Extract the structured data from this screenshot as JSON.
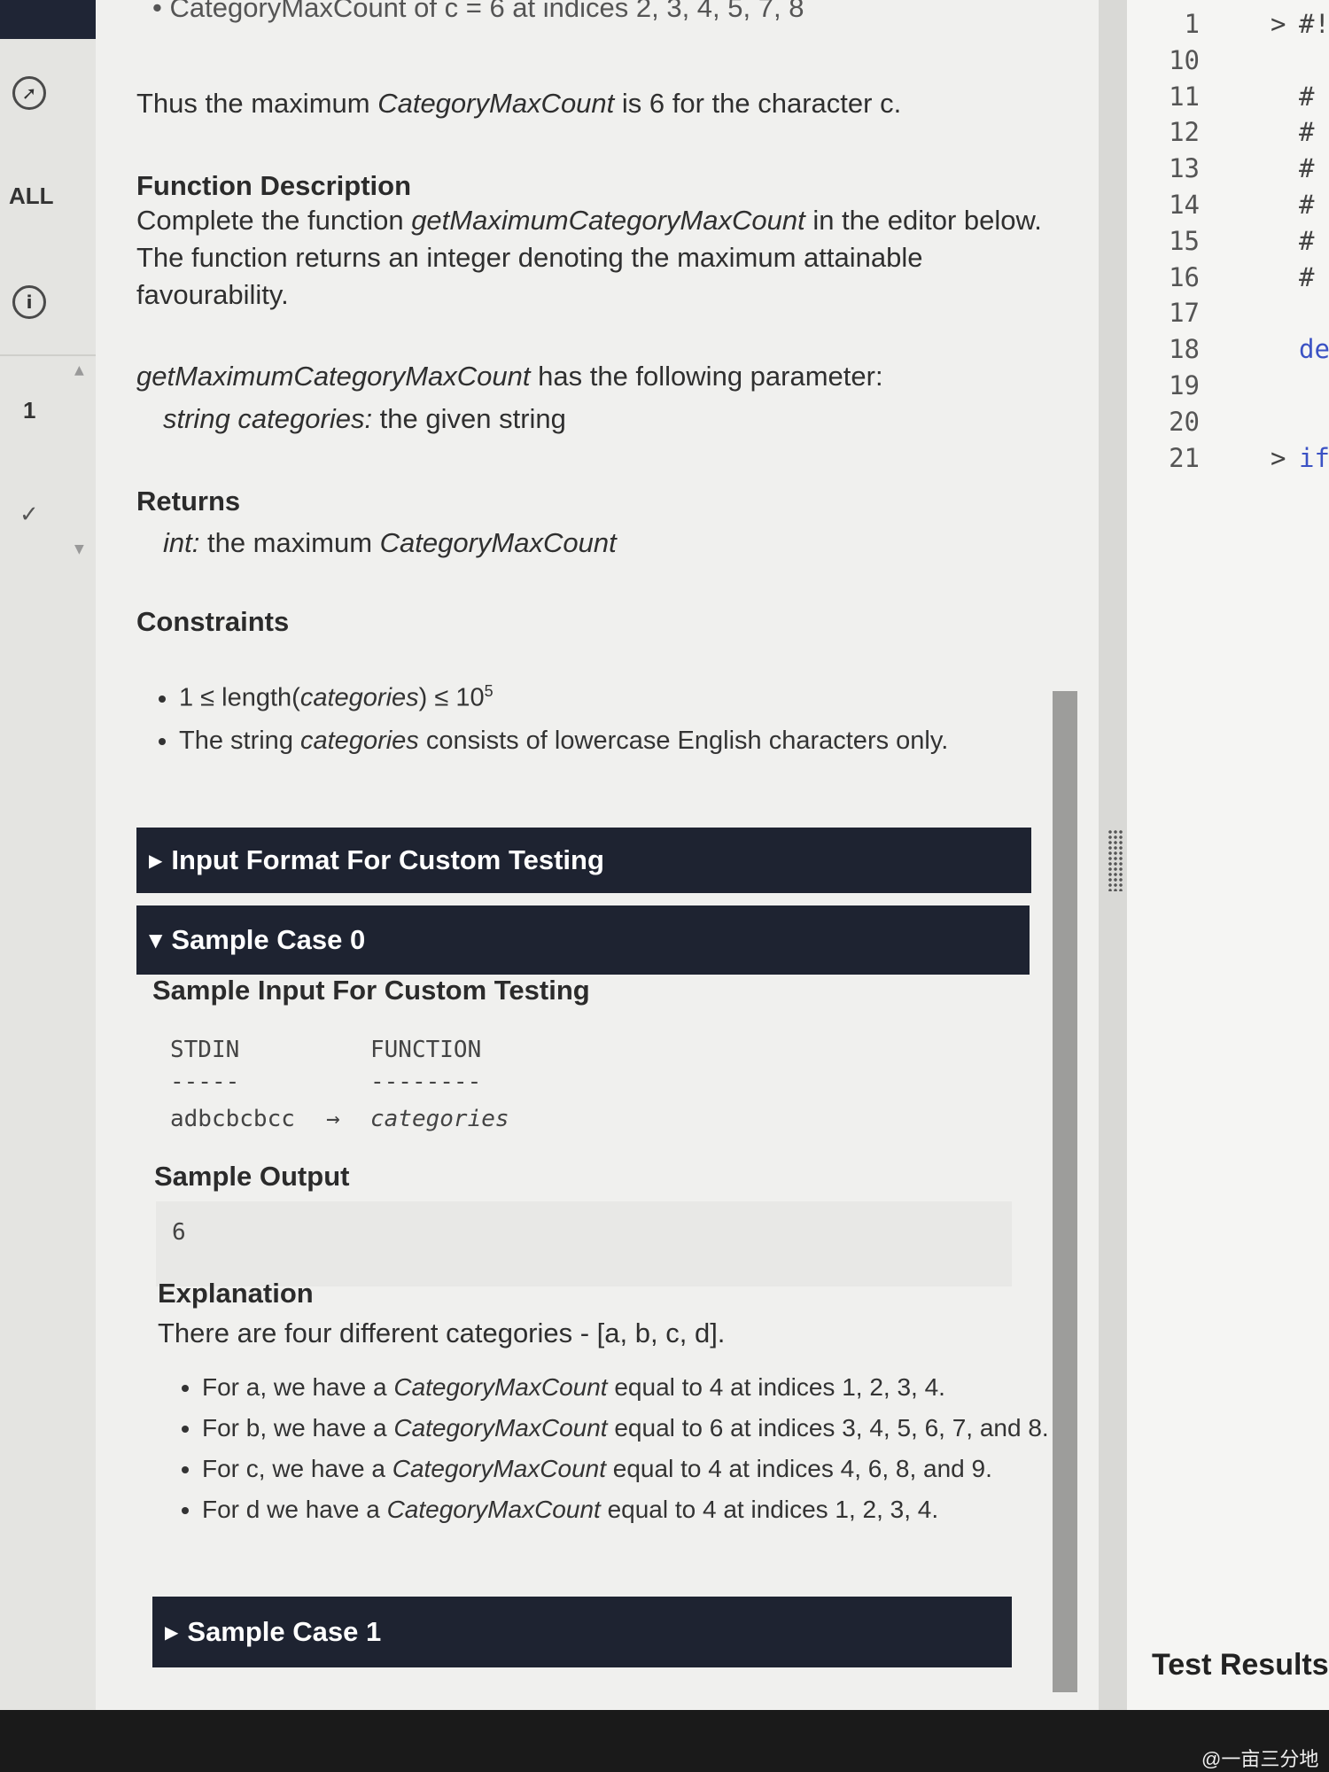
{
  "rail": {
    "filter_label": "ALL",
    "item_number": "1"
  },
  "description": {
    "top_cut_text": "• CategoryMaxCount of c = 6 at indices 2, 3, 4, 5, 7, 8",
    "summary": {
      "pre": "Thus the maximum ",
      "term": "CategoryMaxCount",
      "post": " is 6 for the character c."
    },
    "function_heading": "Function Description",
    "function_body": {
      "pre": "Complete the function ",
      "term": "getMaximumCategoryMaxCount",
      "post": " in the editor below. The function returns an integer denoting the maximum attainable favourability."
    },
    "param_intro": {
      "term": "getMaximumCategoryMaxCount",
      "post": " has the following parameter:"
    },
    "param_line": {
      "term": "string categories:",
      "post": " the given string"
    },
    "returns_heading": "Returns",
    "returns_line": {
      "term": "int:",
      "mid": " the maximum ",
      "term2": "CategoryMaxCount"
    },
    "constraints_heading": "Constraints",
    "constraint1": {
      "pre": "1 ≤ length(",
      "term": "categories",
      "post": ") ≤ 10",
      "sup": "5"
    },
    "constraint2": {
      "pre": "The string ",
      "term": "categories",
      "post": " consists of lowercase English characters only."
    }
  },
  "sections": {
    "input_format": "Input Format For Custom Testing",
    "sample0": "Sample Case 0",
    "sample1": "Sample Case 1"
  },
  "sample0": {
    "input_heading": "Sample Input For Custom Testing",
    "col_stdin": "STDIN",
    "col_function": "FUNCTION",
    "dash_stdin": "-----",
    "dash_function": "--------",
    "stdin_value": "adbcbcbcc",
    "arrow": "→",
    "function_value": "categories",
    "output_heading": "Sample Output",
    "output_value": "6",
    "explanation_heading": "Explanation",
    "explanation_intro": "There are four different categories - [a, b, c, d].",
    "explanations": [
      {
        "pre": "For a, we have a ",
        "term": "CategoryMaxCount",
        "post": " equal to 4 at indices 1, 2, 3, 4."
      },
      {
        "pre": "For b, we have a ",
        "term": "CategoryMaxCount",
        "post": " equal to 6 at indices 3, 4, 5, 6, 7, and 8."
      },
      {
        "pre": "For c, we have a ",
        "term": "CategoryMaxCount",
        "post": " equal to 4 at indices 4, 6, 8, and 9."
      },
      {
        "pre": "For d we have a ",
        "term": "CategoryMaxCount",
        "post": " equal to 4 at indices 1, 2, 3, 4."
      }
    ]
  },
  "editor": {
    "lines": [
      {
        "num": "1",
        "fold": ">",
        "code": "#!"
      },
      {
        "num": "10",
        "fold": "",
        "code": ""
      },
      {
        "num": "11",
        "fold": "",
        "code": "#"
      },
      {
        "num": "12",
        "fold": "",
        "code": "#"
      },
      {
        "num": "13",
        "fold": "",
        "code": "#"
      },
      {
        "num": "14",
        "fold": "",
        "code": "#"
      },
      {
        "num": "15",
        "fold": "",
        "code": "#"
      },
      {
        "num": "16",
        "fold": "",
        "code": "#"
      },
      {
        "num": "17",
        "fold": "",
        "code": ""
      },
      {
        "num": "18",
        "fold": "",
        "code": "de"
      },
      {
        "num": "19",
        "fold": "",
        "code": ""
      },
      {
        "num": "20",
        "fold": "",
        "code": ""
      },
      {
        "num": "21",
        "fold": ">",
        "code": "if"
      }
    ],
    "test_results_label": "Test Results"
  },
  "watermark": "@一亩三分地",
  "colors": {
    "bar_bg": "#1e2331",
    "panel_bg": "#f0f0ee",
    "code_keyword": "#3b52c4"
  }
}
